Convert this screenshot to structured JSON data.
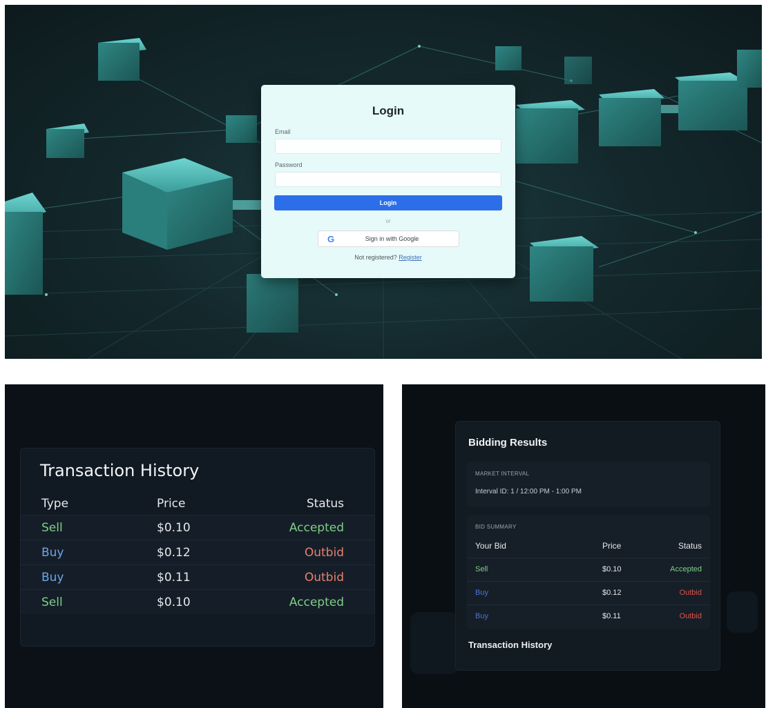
{
  "login": {
    "title": "Login",
    "email_label": "Email",
    "email_value": "",
    "password_label": "Password",
    "password_value": "",
    "submit_label": "Login",
    "divider_text": "or",
    "google_icon": "G",
    "google_label": "Sign in with Google",
    "register_prompt": "Not registered?",
    "register_link": "Register",
    "colors": {
      "card": "#e7fafa",
      "button": "#2c6ee9",
      "background": "#14292d"
    }
  },
  "transaction_history": {
    "title": "Transaction History",
    "columns": [
      "Type",
      "Price",
      "Status"
    ],
    "rows": [
      {
        "type": "Sell",
        "price": "$0.10",
        "status": "Accepted"
      },
      {
        "type": "Buy",
        "price": "$0.12",
        "status": "Outbid"
      },
      {
        "type": "Buy",
        "price": "$0.11",
        "status": "Outbid"
      },
      {
        "type": "Sell",
        "price": "$0.10",
        "status": "Accepted"
      }
    ]
  },
  "bidding_results": {
    "title": "Bidding Results",
    "market_interval_label": "MARKET INTERVAL",
    "interval_text": "Interval ID: 1 / 12:00 PM - 1:00 PM",
    "bid_summary_label": "BID SUMMARY",
    "columns": [
      "Your Bid",
      "Price",
      "Status"
    ],
    "rows": [
      {
        "bid": "Sell",
        "price": "$0.10",
        "status": "Accepted"
      },
      {
        "bid": "Buy",
        "price": "$0.12",
        "status": "Outbid"
      },
      {
        "bid": "Buy",
        "price": "$0.11",
        "status": "Outbid"
      }
    ],
    "transaction_history_heading": "Transaction History"
  },
  "colors": {
    "sell": "#7fcf86",
    "buy": "#6ea6e6",
    "accepted": "#7fcf86",
    "outbid": "#e8806e",
    "outbid_strong": "#e0504a",
    "panel_bg": "#0b1117"
  }
}
